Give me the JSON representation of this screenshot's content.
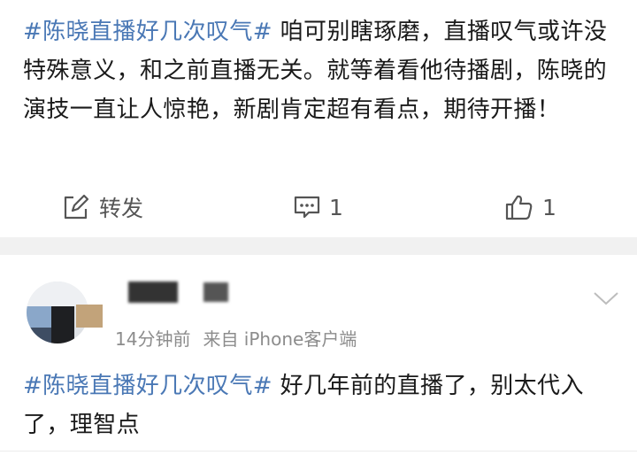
{
  "post": {
    "topic": "#陈晓直播好几次叹气#",
    "text": " 咱可别瞎琢磨，直播叹气或许没特殊意义，和之前直播无关。就等着看他待播剧，陈晓的演技一直让人惊艳，新剧肯定超有看点，期待开播！",
    "actions": {
      "repost_label": "转发",
      "comment_count": "1",
      "like_count": "1"
    }
  },
  "comment": {
    "time": "14分钟前",
    "source": "来自 iPhone客户端",
    "topic": "#陈晓直播好几次叹气#",
    "text": " 好几年前的直播了，别太代入了，理智点"
  },
  "colors": {
    "topic_link": "#4a78b5",
    "meta_gray": "#8c8c8c",
    "divider": "#f1f1f1"
  },
  "icons": {
    "repost": "edit-share-icon",
    "comment": "comment-bubble-icon",
    "like": "thumbs-up-icon",
    "more": "chevron-down-icon"
  }
}
